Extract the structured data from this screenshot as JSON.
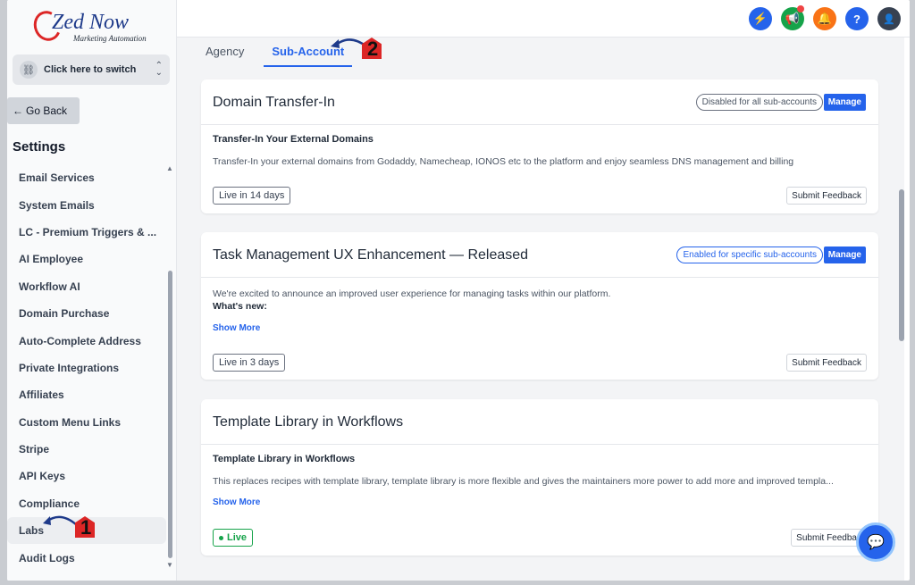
{
  "brand": {
    "logo_main": "Zed Now",
    "logo_sub": "Marketing Automation"
  },
  "sidebar": {
    "switcher_label": "Click here to switch",
    "go_back": "Go Back",
    "section_title": "Settings",
    "items": [
      {
        "label": "Email Services"
      },
      {
        "label": "System Emails"
      },
      {
        "label": "LC - Premium Triggers & ..."
      },
      {
        "label": "AI Employee"
      },
      {
        "label": "Workflow AI"
      },
      {
        "label": "Domain Purchase"
      },
      {
        "label": "Auto-Complete Address"
      },
      {
        "label": "Private Integrations"
      },
      {
        "label": "Affiliates"
      },
      {
        "label": "Custom Menu Links"
      },
      {
        "label": "Stripe"
      },
      {
        "label": "API Keys"
      },
      {
        "label": "Compliance"
      },
      {
        "label": "Labs"
      },
      {
        "label": "Audit Logs"
      }
    ],
    "active_item": "Labs"
  },
  "topbar": {
    "icons": [
      "lightning-icon",
      "megaphone-icon",
      "bell-icon",
      "help-icon",
      "avatar"
    ],
    "help_glyph": "?"
  },
  "tabs": [
    {
      "label": "Agency",
      "active": false
    },
    {
      "label": "Sub-Account",
      "active": true
    }
  ],
  "cards": [
    {
      "title": "Domain Transfer-In",
      "status": "Disabled for all sub-accounts",
      "manage": "Manage",
      "subtitle": "Transfer-In Your External Domains",
      "description": "Transfer-In your external domains from Godaddy, Namecheap, IONOS etc to the platform and enjoy seamless DNS management and billing",
      "live": "Live in 14 days",
      "feedback": "Submit Feedback"
    },
    {
      "title": "Task Management UX Enhancement — Released",
      "status": "Enabled for specific sub-accounts",
      "manage": "Manage",
      "description": "We're excited to announce an improved user experience for managing tasks within our platform.",
      "whats_new": "What's new:",
      "show_more": "Show More",
      "live": "Live in 3 days",
      "feedback": "Submit Feedback"
    },
    {
      "title": "Template Library in Workflows",
      "subtitle": "Template Library in Workflows",
      "description": "This replaces recipes with template library, template library is more flexible and gives the maintainers more power to add more and improved templa...",
      "show_more": "Show More",
      "live": "Live",
      "feedback": "Submit Feedbac"
    }
  ],
  "annotations": {
    "step1": "1",
    "step2": "2"
  },
  "colors": {
    "accent": "#2563eb",
    "annotation": "#dc2626",
    "live_green": "#16a34a"
  }
}
